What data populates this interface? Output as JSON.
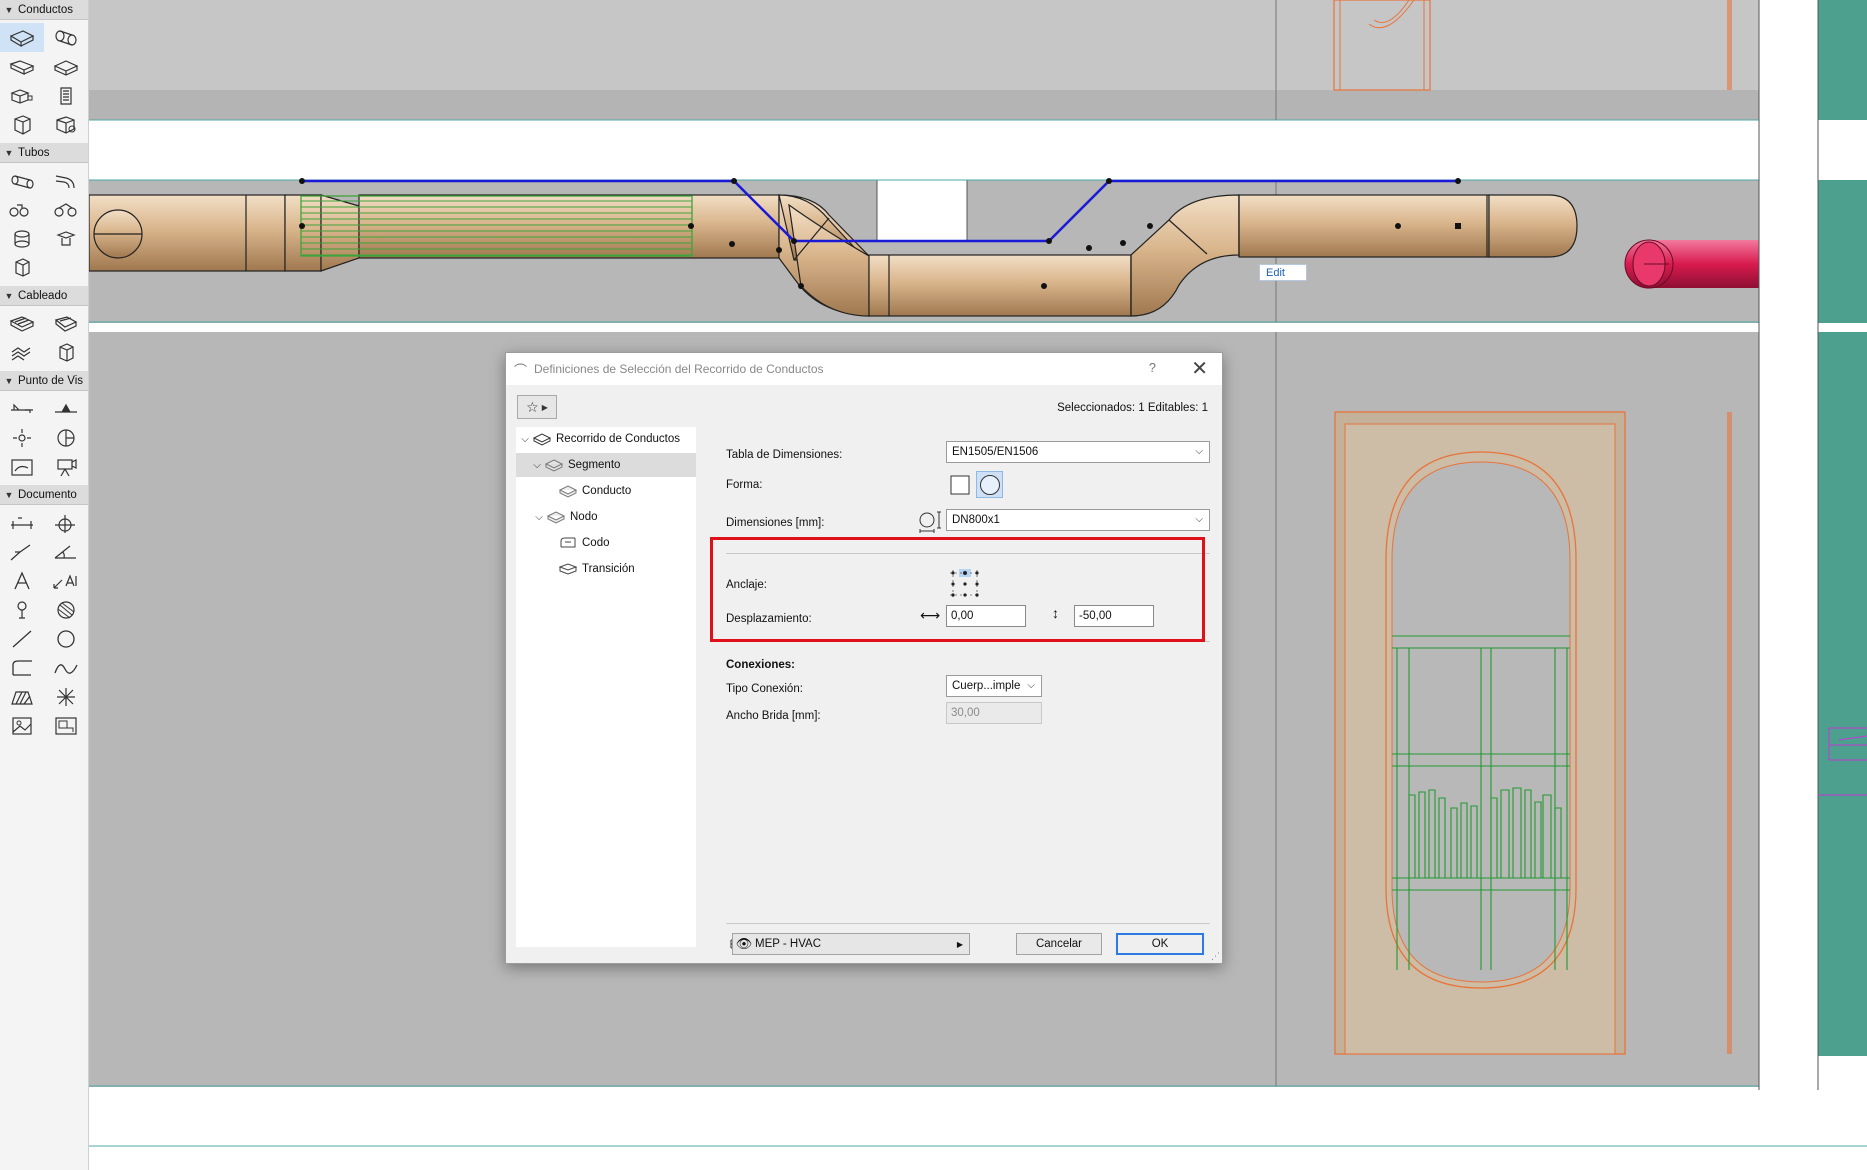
{
  "toolbox": {
    "sections": [
      {
        "label": "Conductos",
        "tools": [
          "duct-straight-icon",
          "duct-round-icon",
          "duct-transition-icon",
          "duct-branch-icon",
          "duct-terminal-icon",
          "duct-flexible-icon",
          "duct-equipment-icon",
          "duct-accessory-icon"
        ]
      },
      {
        "label": "Tubos",
        "tools": [
          "pipe-straight-icon",
          "pipe-bend-icon",
          "pipe-branch-icon",
          "pipe-multi-icon",
          "pipe-equipment-icon",
          "pipe-fitting-icon",
          "pipe-accessory-icon"
        ]
      },
      {
        "label": "Cableado",
        "tools": [
          "cable-tray-icon",
          "cable-tray-bend-icon",
          "cable-equipment-icon",
          "cable-accessory-icon"
        ]
      },
      {
        "label": "Punto de Vis",
        "tools": [
          "section-icon",
          "elevation-icon",
          "interior-elevation-icon",
          "worksheet-icon",
          "detail-icon",
          "camera-icon"
        ]
      },
      {
        "label": "Documento",
        "tools": [
          "dimension-icon",
          "level-dimension-icon",
          "radial-dimension-icon",
          "angle-dimension-icon",
          "text-icon",
          "label-icon",
          "marker-icon",
          "fill-icon",
          "line-icon",
          "circle-icon",
          "polyline-icon",
          "spline-icon",
          "hatch-icon",
          "hotspot-icon",
          "figure-icon",
          "drawing-icon"
        ]
      }
    ]
  },
  "canvas": {
    "edit_tag": "Edit"
  },
  "dialog": {
    "title": "Definiciones de Selección del Recorrido de Conductos",
    "help": "?",
    "close": "✕",
    "selection_info": "Seleccionados: 1 Editables: 1",
    "tree": [
      {
        "label": "Recorrido de Conductos",
        "icon": "duct-route-icon"
      },
      {
        "label": "Segmento",
        "icon": "segment-icon",
        "selected": true
      },
      {
        "label": "Conducto",
        "icon": "duct-icon"
      },
      {
        "label": "Nodo",
        "icon": "node-icon"
      },
      {
        "label": "Codo",
        "icon": "elbow-icon"
      },
      {
        "label": "Transición",
        "icon": "transition-icon"
      }
    ],
    "fields": {
      "tabla_label": "Tabla de Dimensiones:",
      "tabla_value": "EN1505/EN1506",
      "forma_label": "Forma:",
      "forma_selected": "round",
      "dimensiones_label": "Dimensiones [mm]:",
      "dimensiones_value": "DN800x1",
      "anclaje_label": "Anclaje:",
      "desplazamiento_label": "Desplazamiento:",
      "offset_h": "0,00",
      "offset_v": "-50,00",
      "conexiones_label": "Conexiones:",
      "tipo_conexion_label": "Tipo Conexión:",
      "tipo_conexion_value": "Cuerp...imple",
      "ancho_brida_label": "Ancho Brida [mm]:",
      "ancho_brida_value": "30,00"
    },
    "footer": {
      "layer": "MEP - HVAC",
      "cancel": "Cancelar",
      "ok": "OK"
    }
  },
  "colors": {
    "highlight": "#e0101a",
    "route_line": "#1a1ad6",
    "duct_fill": "#d9b58c",
    "selected_segment": "#5fbf4a",
    "pink_duct": "#d81b4f",
    "door_outline": "#e8743b",
    "shelf_lines": "#1f9a2f"
  }
}
